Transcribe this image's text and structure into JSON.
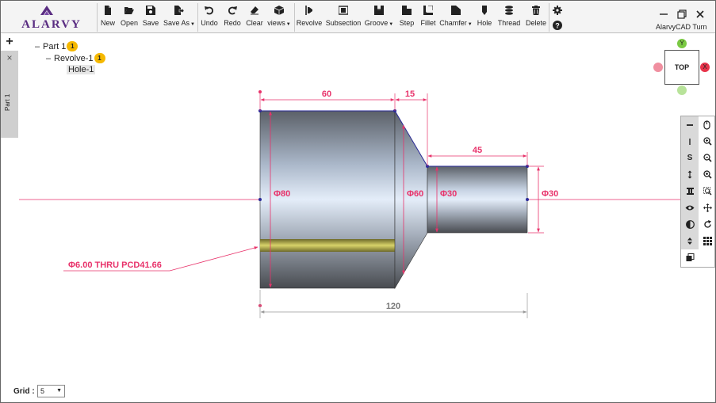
{
  "app": {
    "logo_text": "ALARVY",
    "title": "AlarvyCAD Turn"
  },
  "toolbar": {
    "file": [
      {
        "label": "New",
        "icon": "file-icon"
      },
      {
        "label": "Open",
        "icon": "folder-open-icon"
      },
      {
        "label": "Save",
        "icon": "save-icon"
      },
      {
        "label": "Save As",
        "icon": "file-export-icon",
        "dropdown": true
      }
    ],
    "edit": [
      {
        "label": "Undo",
        "icon": "undo-icon"
      },
      {
        "label": "Redo",
        "icon": "redo-icon"
      },
      {
        "label": "Clear",
        "icon": "eraser-icon"
      },
      {
        "label": "views",
        "icon": "cube-icon",
        "dropdown": true
      }
    ],
    "features": [
      {
        "label": "Revolve",
        "icon": "revolve-icon"
      },
      {
        "label": "Subsection",
        "icon": "subsection-icon"
      },
      {
        "label": "Groove",
        "icon": "groove-icon",
        "dropdown": true
      },
      {
        "label": "Step",
        "icon": "step-icon"
      },
      {
        "label": "Fillet",
        "icon": "fillet-icon"
      },
      {
        "label": "Chamfer",
        "icon": "chamfer-icon",
        "dropdown": true
      },
      {
        "label": "Hole",
        "icon": "hole-icon"
      },
      {
        "label": "Thread",
        "icon": "thread-icon"
      },
      {
        "label": "Delete",
        "icon": "trash-icon"
      }
    ]
  },
  "tabs": {
    "add": "+",
    "close": "×",
    "active": "Part 1"
  },
  "tree": {
    "part": {
      "label": "Part 1",
      "badge": "1"
    },
    "revolve": {
      "label": "Revolve-1",
      "badge": "1"
    },
    "hole": {
      "label": "Hole-1"
    }
  },
  "drawing": {
    "dims": {
      "len_60": "60",
      "len_15": "15",
      "len_45": "45",
      "len_120": "120",
      "dia_80": "Φ80",
      "dia_60": "Φ60",
      "dia_30_inner": "Φ30",
      "dia_30_outer": "Φ30"
    },
    "hole_callout": "Φ6.00 THRU PCD41.66",
    "colors": {
      "dimension": "#e8336b",
      "axis": "#e8336b",
      "body_dark": "#4e5258",
      "body_light": "#dfe8f5",
      "hole": "#b7b23a",
      "outline": "#2b2b9a"
    }
  },
  "viewcube": {
    "face": "TOP",
    "y_label": "Y",
    "x_label": "X"
  },
  "grid": {
    "label": "Grid :",
    "value": "5"
  }
}
